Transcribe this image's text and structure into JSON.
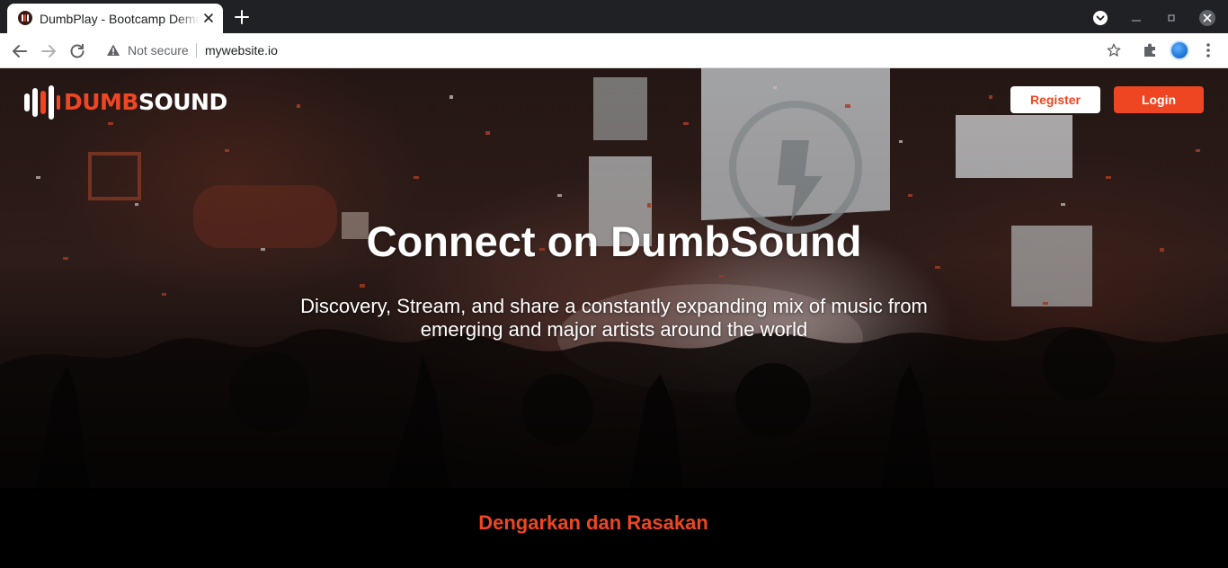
{
  "browser": {
    "tab": {
      "title": "DumbPlay - Bootcamp Demo",
      "favicon": "dumbsound-favicon"
    },
    "new_tab_icon": "plus-icon",
    "address_bar": {
      "security_label": "Not secure",
      "url": "mywebsite.io"
    },
    "icons": [
      "back-arrow-icon",
      "forward-arrow-icon",
      "reload-icon",
      "warning-icon",
      "star-icon",
      "extensions-puzzle-icon",
      "profile-avatar",
      "kebab-menu-icon",
      "tab-search-icon",
      "minimize-icon",
      "restore-icon",
      "close-window-icon"
    ]
  },
  "site": {
    "logo": {
      "part1": "DUMB",
      "part2": "SOUND"
    },
    "nav": {
      "register_label": "Register",
      "login_label": "Login"
    },
    "hero": {
      "title": "Connect on DumbSound",
      "subtitle": "Discovery, Stream, and share a constantly expanding mix of music from emerging and major artists around the world"
    },
    "section": {
      "title": "Dengarkan dan Rasakan"
    }
  },
  "colors": {
    "brand": "#ee4622",
    "page_background": "#000000",
    "chrome_dark": "#202124"
  }
}
